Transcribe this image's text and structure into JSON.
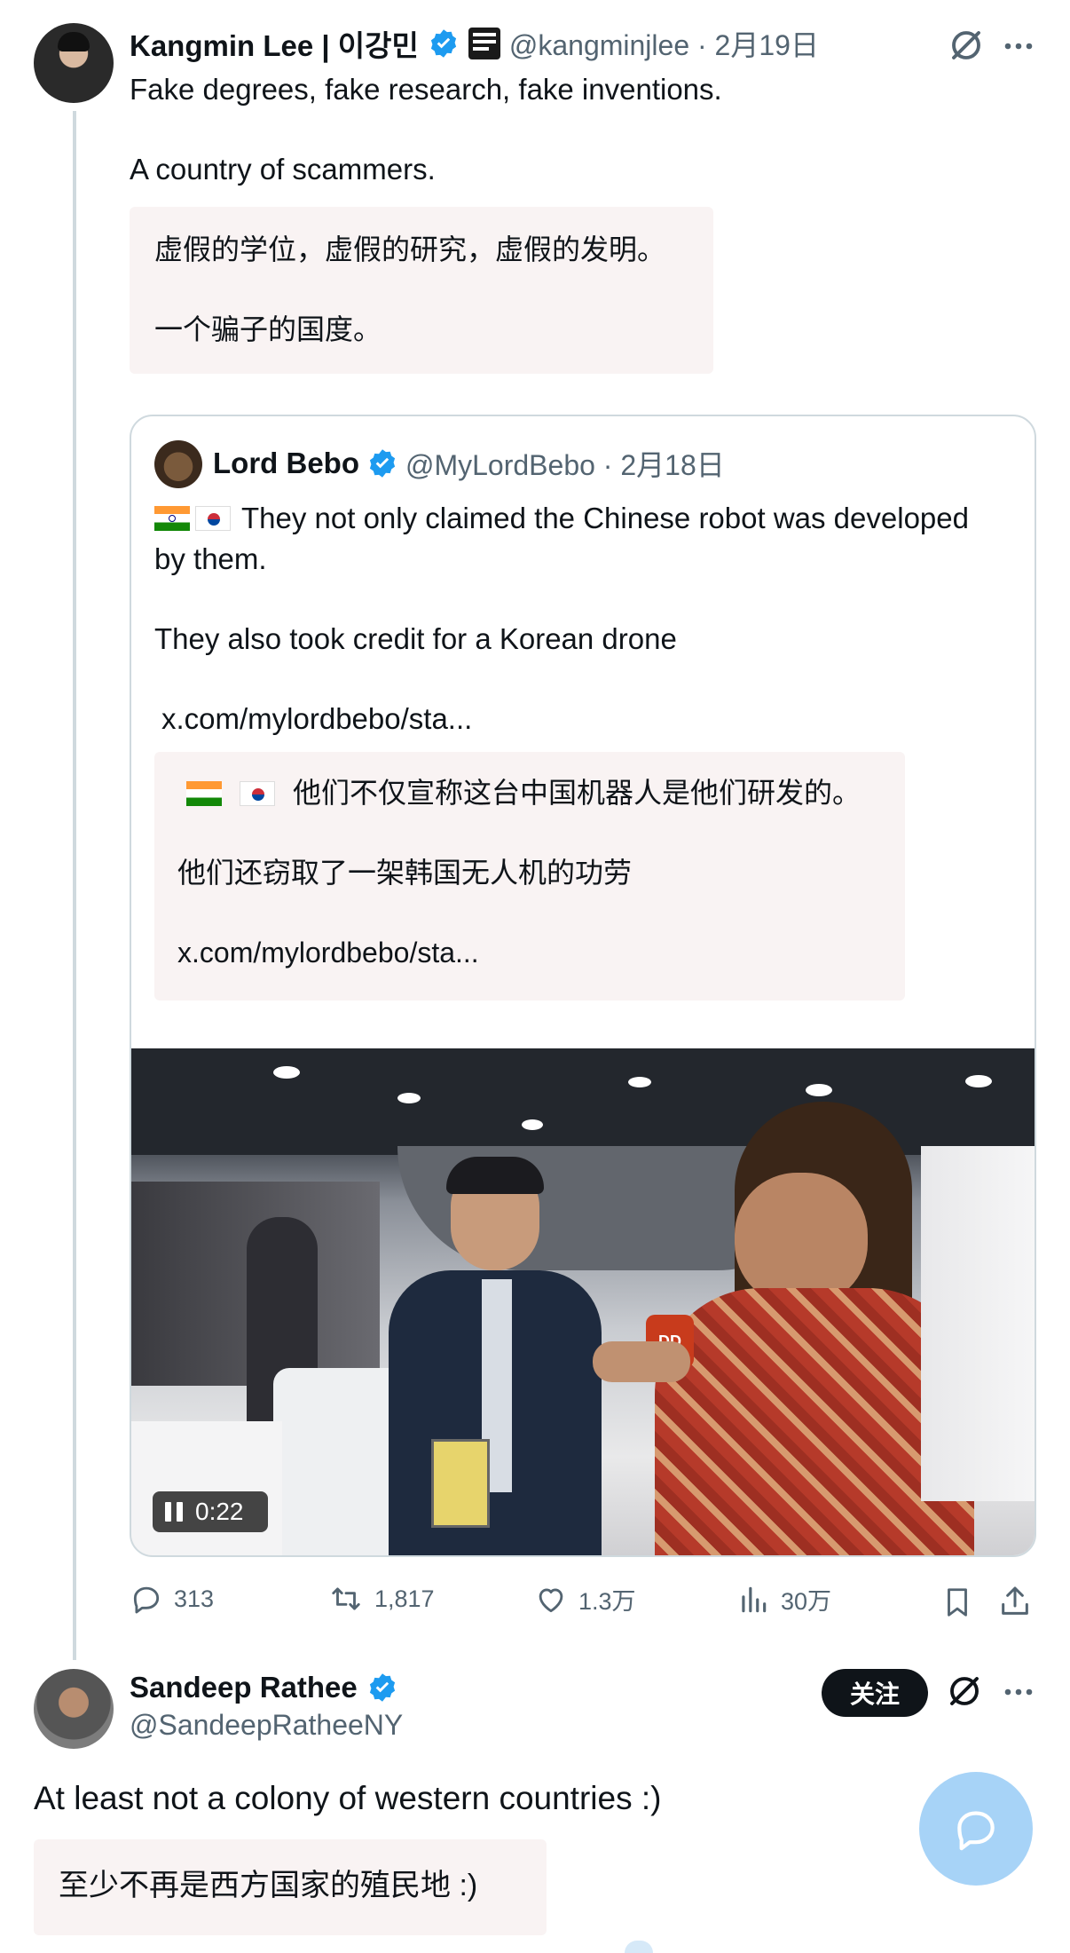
{
  "post": {
    "author_name": "Kangmin Lee | 이강민",
    "handle_date": "@kangminjlee · 2月19日",
    "body_line1": "Fake degrees, fake research, fake inventions.",
    "body_line2": "A country of scammers.",
    "translation_line1": "虚假的学位，虚假的研究，虚假的发明。",
    "translation_line2": "一个骗子的国度。"
  },
  "quote": {
    "author_name": "Lord Bebo",
    "handle_date": "@MyLordBebo · 2月18日",
    "body_line1": "They not only claimed the Chinese robot was developed",
    "body_line2": "by them.",
    "body_line3": "They also took credit for a Korean drone",
    "link": "x.com/mylordbebo/sta...",
    "translation_line1": "他们不仅宣称这台中国机器人是他们研发的。",
    "translation_line2": "他们还窃取了一架韩国无人机的功劳",
    "translation_link": "x.com/mylordbebo/sta...",
    "video": {
      "duration": "0:22",
      "mic_label": "DD"
    }
  },
  "actions": {
    "replies": "313",
    "reposts": "1,817",
    "likes": "1.3万",
    "views": "30万"
  },
  "reply": {
    "author_name": "Sandeep Rathee",
    "handle": "@SandeepRatheeNY",
    "follow_label": "关注",
    "body": "At least not a colony of western countries :)",
    "translation": "至少不再是西方国家的殖民地 :)"
  },
  "colors": {
    "verified_blue": "#1d9bf0",
    "muted": "#536471",
    "fab": "#a7d3f7"
  }
}
